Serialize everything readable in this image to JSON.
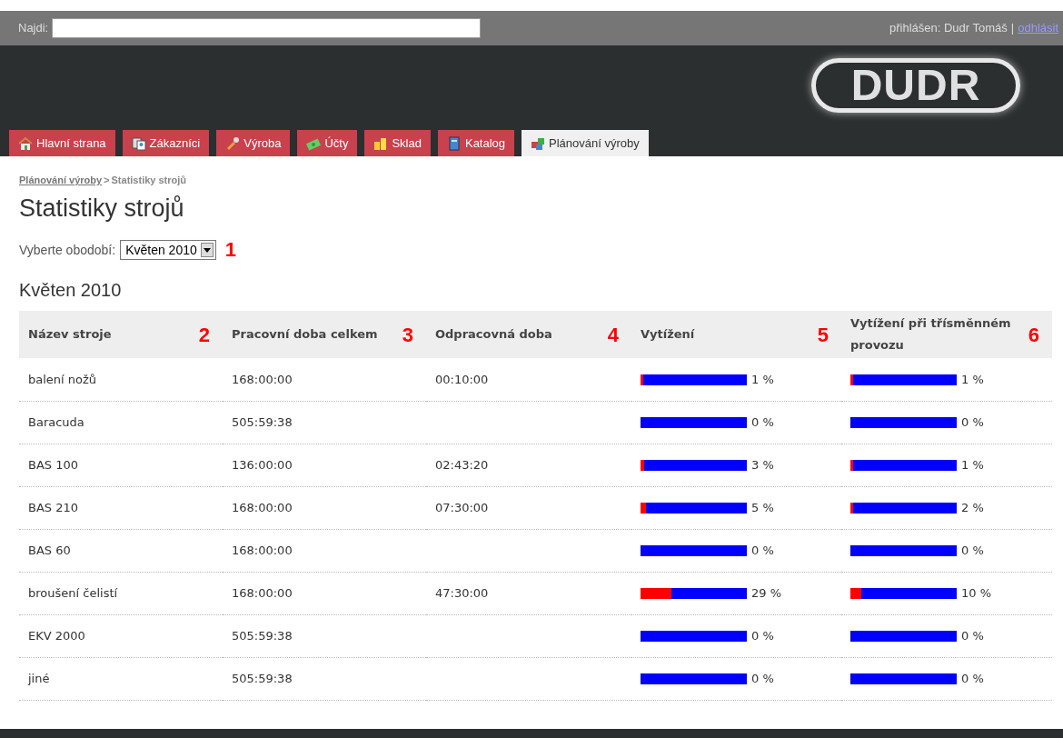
{
  "search": {
    "label": "Najdi:"
  },
  "user": {
    "logged_in": "přihlášen: Dudr Tomáš",
    "separator": "|",
    "logout": "odhlásit"
  },
  "logo": {
    "text": "DUDR"
  },
  "tabs": [
    {
      "label": "Hlavní strana",
      "selected": false
    },
    {
      "label": "Zákazníci",
      "selected": false
    },
    {
      "label": "Výroba",
      "selected": false
    },
    {
      "label": "Účty",
      "selected": false
    },
    {
      "label": "Sklad",
      "selected": false
    },
    {
      "label": "Katalog",
      "selected": false
    },
    {
      "label": "Plánování výroby",
      "selected": true
    }
  ],
  "breadcrumb": {
    "link": "Plánování výroby",
    "separator": ">",
    "current": "Statistiky strojů"
  },
  "title": "Statistiky strojů",
  "period": {
    "label": "Vyberte obodobí:",
    "value": "Květen 2010",
    "annotation": "1"
  },
  "section_title": "Květen 2010",
  "table": {
    "columns": [
      {
        "label": "Název stroje",
        "annotation": "2"
      },
      {
        "label": "Pracovní doba celkem",
        "annotation": "3"
      },
      {
        "label": "Odpracovná doba",
        "annotation": "4"
      },
      {
        "label": "Vytížení",
        "annotation": "5"
      },
      {
        "label": "Vytížení při třísměnném provozu",
        "annotation": "6"
      }
    ],
    "rows": [
      {
        "name": "balení nožů",
        "total": "168:00:00",
        "worked": "00:10:00",
        "usage": {
          "level": 0.01,
          "reading": "1 %"
        },
        "usage3": {
          "level": 0.01,
          "reading": "1 %"
        }
      },
      {
        "name": "Baracuda",
        "total": "505:59:38",
        "usage": {
          "level": 0,
          "reading": "0 %"
        },
        "usage3": {
          "level": 0,
          "reading": "0 %"
        }
      },
      {
        "name": "BAS 100",
        "total": "136:00:00",
        "worked": "02:43:20",
        "usage": {
          "level": 0.03,
          "reading": "3 %"
        },
        "usage3": {
          "level": 0.01,
          "reading": "1 %"
        }
      },
      {
        "name": "BAS 210",
        "total": "168:00:00",
        "worked": "07:30:00",
        "usage": {
          "level": 0.05,
          "reading": "5 %"
        },
        "usage3": {
          "level": 0.02,
          "reading": "2 %"
        }
      },
      {
        "name": "BAS 60",
        "total": "168:00:00",
        "usage": {
          "level": 0,
          "reading": "0 %"
        },
        "usage3": {
          "level": 0,
          "reading": "0 %"
        }
      },
      {
        "name": "broušení čelistí",
        "total": "168:00:00",
        "worked": "47:30:00",
        "usage": {
          "level": 0.29,
          "reading": "29 %"
        },
        "usage3": {
          "level": 0.1,
          "reading": "10 %"
        }
      },
      {
        "name": "EKV 2000",
        "total": "505:59:38",
        "usage": {
          "level": 0,
          "reading": "0 %"
        },
        "usage3": {
          "level": 0,
          "reading": "0 %"
        }
      },
      {
        "name": "jiné",
        "total": "505:59:38",
        "usage": {
          "level": 0,
          "reading": "0 %"
        },
        "usage3": {
          "level": 0,
          "reading": "0 %"
        }
      }
    ]
  }
}
